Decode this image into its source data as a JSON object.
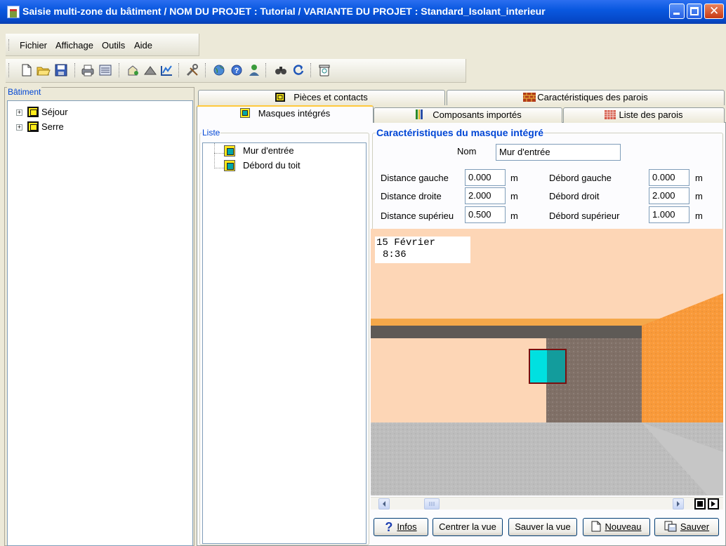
{
  "window": {
    "title": "Saisie multi-zone du bâtiment  /  NOM DU PROJET : Tutorial  /  VARIANTE DU PROJET : Standard_Isolant_interieur"
  },
  "menu": {
    "items": [
      "Fichier",
      "Affichage",
      "Outils",
      "Aide"
    ]
  },
  "toolbar": {
    "icons": [
      "new-file-icon",
      "open-folder-icon",
      "save-disk-icon",
      "print-icon",
      "list-icon",
      "building-edit-icon",
      "roof-icon",
      "chart-icon",
      "tools-icon",
      "globe-icon",
      "help-icon",
      "users-icon",
      "binoculars-icon",
      "refresh-icon",
      "bin-icon"
    ]
  },
  "left_panel": {
    "label": "Bâtiment",
    "tree": [
      {
        "label": "Séjour",
        "expander": "+"
      },
      {
        "label": "Serre",
        "expander": "+"
      }
    ]
  },
  "tabs": {
    "row1": [
      "Pièces et contacts",
      "Caractéristiques des parois"
    ],
    "row2": [
      "Masques intégrés",
      "Composants importés",
      "Liste des parois"
    ],
    "active": "Masques intégrés"
  },
  "list_group": {
    "label": "Liste",
    "items": [
      "Mur d'entrée",
      "Débord du toit"
    ]
  },
  "characteristics": {
    "label": "Caractéristiques du masque intégré",
    "nom_label": "Nom",
    "nom_value": "Mur d'entrée",
    "left_fields": [
      {
        "label": "Distance gauche",
        "value": "0.000",
        "unit": "m"
      },
      {
        "label": "Distance droite",
        "value": "2.000",
        "unit": "m"
      },
      {
        "label": "Distance supérieu",
        "value": "0.500",
        "unit": "m"
      }
    ],
    "right_fields": [
      {
        "label": "Débord gauche",
        "value": "0.000",
        "unit": "m"
      },
      {
        "label": "Débord droit",
        "value": "2.000",
        "unit": "m"
      },
      {
        "label": "Débord supérieur",
        "value": "1.000",
        "unit": "m"
      }
    ]
  },
  "view3d": {
    "date": "15 Février",
    "time": "8:36"
  },
  "buttons": {
    "infos": "Infos",
    "centrer": "Centrer la vue",
    "sauver_vue": "Sauver la vue",
    "nouveau": "Nouveau",
    "sauver": "Sauver"
  },
  "colors": {
    "titlebar": "#0a58e0",
    "group_label": "#0046d5",
    "sky": "#fdd6b6",
    "wall_orange": "#f99a3a",
    "window_cyan": "#00e0e0"
  }
}
